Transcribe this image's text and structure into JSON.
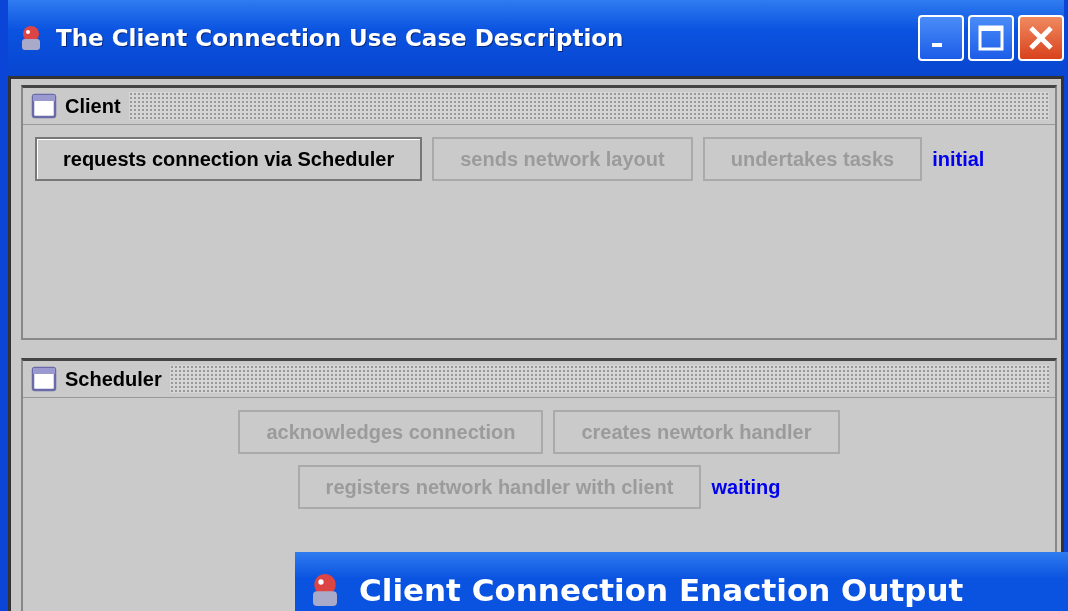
{
  "window": {
    "title": "The Client Connection Use Case Description"
  },
  "panels": [
    {
      "title": "Client",
      "rows": [
        {
          "buttons": [
            {
              "label": "requests connection via Scheduler",
              "disabled": false
            },
            {
              "label": "sends network layout",
              "disabled": true
            },
            {
              "label": "undertakes tasks",
              "disabled": true
            }
          ],
          "status": "initial"
        }
      ],
      "kind": "flow"
    },
    {
      "title": "Scheduler",
      "rows": [
        {
          "buttons": [
            {
              "label": "acknowledges connection",
              "disabled": true
            },
            {
              "label": "creates newtork handler",
              "disabled": true
            }
          ]
        },
        {
          "buttons": [
            {
              "label": "registers network handler with client",
              "disabled": true
            }
          ],
          "status": "waiting"
        }
      ],
      "kind": "centered"
    }
  ],
  "second_window": {
    "title": "Client Connection Enaction Output"
  }
}
